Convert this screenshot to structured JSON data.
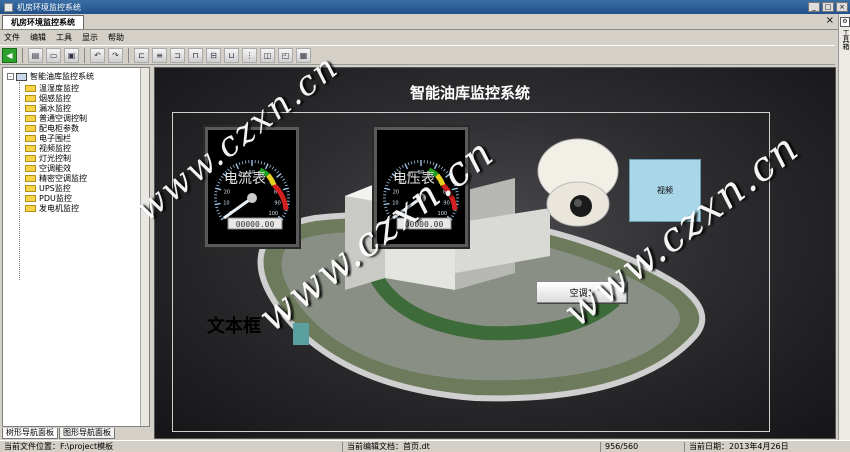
{
  "window": {
    "title": "机房环境监控系统"
  },
  "document_tab": {
    "label": "机房环境监控系统",
    "close": "×"
  },
  "menu": [
    "文件",
    "编辑",
    "工具",
    "显示",
    "帮助"
  ],
  "toolbar_icons": [
    "run-icon",
    "new-icon",
    "open-icon",
    "save-icon",
    "undo-icon",
    "redo-icon",
    "align-left-icon",
    "align-center-icon",
    "align-right-icon",
    "align-top-icon",
    "align-middle-icon",
    "align-bottom-icon",
    "distribute-icon",
    "group-icon",
    "ungroup-icon",
    "layer-icon"
  ],
  "right_strip": {
    "label": "工具箱"
  },
  "tree": {
    "root": "智能油库监控系统",
    "items": [
      "温湿度监控",
      "烟感监控",
      "漏水监控",
      "普通空调控制",
      "配电柜参数",
      "电子围栏",
      "视频监控",
      "灯光控制",
      "空调能效",
      "精密空调监控",
      "UPS监控",
      "PDU监控",
      "发电机监控"
    ]
  },
  "nav_tabs": [
    "树形导航面板",
    "图形导航面板"
  ],
  "canvas": {
    "title": "智能油库监控系统",
    "gauge1": {
      "name": "电流表",
      "digits": "00000.00"
    },
    "gauge2": {
      "name": "电压表",
      "digits": "00000.00"
    },
    "camera_label": "视频",
    "ac_button": "空调1",
    "textbox": "文本框",
    "ticks": [
      "0",
      "10",
      "20",
      "30",
      "40",
      "50",
      "60",
      "70",
      "80",
      "90",
      "100"
    ]
  },
  "status": {
    "file_path": "当前文件位置：F:\\project模板",
    "edit_doc": "当前编辑文档：首页.dt",
    "coords": "956/560",
    "date": "当前日期：2013年4月26日"
  },
  "watermark": "www.czxn.cn",
  "colors": {
    "accent_green": "#2ea02e",
    "gauge_needle": "#e8f0f8",
    "camera_panel": "#a9d6e8"
  }
}
